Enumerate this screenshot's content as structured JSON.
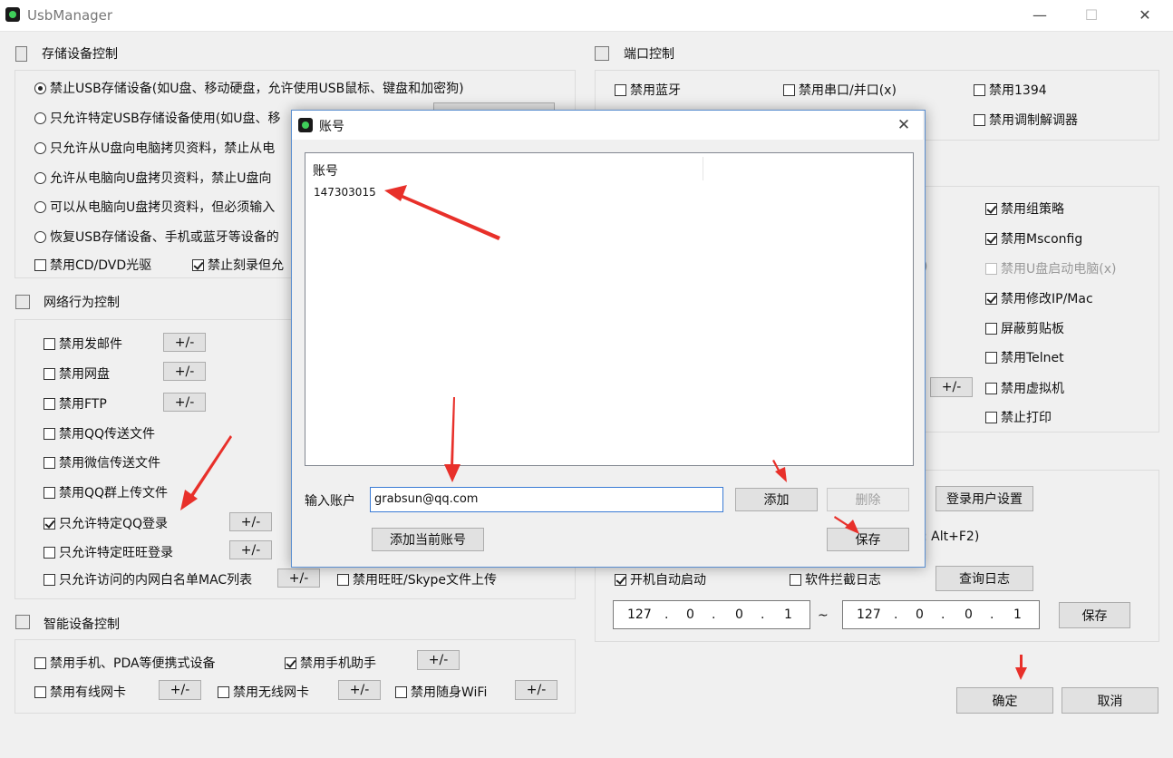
{
  "window": {
    "title": "UsbManager",
    "minimize": "—",
    "maximize": "☐",
    "close": "✕"
  },
  "storage": {
    "title": "存储设备控制",
    "radios": [
      {
        "label": "禁止USB存储设备(如U盘、移动硬盘，允许使用USB鼠标、键盘和加密狗)",
        "selected": true
      },
      {
        "label": "只允许特定USB存储设备使用(如U盘、移",
        "selected": false
      },
      {
        "label": "只允许从U盘向电脑拷贝资料，禁止从电",
        "selected": false
      },
      {
        "label": "允许从电脑向U盘拷贝资料，禁止U盘向",
        "selected": false
      },
      {
        "label": "可以从电脑向U盘拷贝资料，但必须输入",
        "selected": false
      },
      {
        "label": "恢复USB存储设备、手机或蓝牙等设备的",
        "selected": false
      }
    ],
    "cd_dvd": {
      "label": "禁用CD/DVD光驱",
      "checked": false
    },
    "burn": {
      "label": "禁止刻录但允",
      "checked": true
    }
  },
  "network": {
    "title": "网络行为控制",
    "items": [
      {
        "label": "禁用发邮件",
        "checked": false,
        "btn": "+/-"
      },
      {
        "label": "禁用网盘",
        "checked": false,
        "btn": "+/-"
      },
      {
        "label": "禁用FTP",
        "checked": false,
        "btn": "+/-"
      },
      {
        "label": "禁用QQ传送文件",
        "checked": false,
        "btn": ""
      },
      {
        "label": "禁用微信传送文件",
        "checked": false,
        "btn": ""
      },
      {
        "label": "禁用QQ群上传文件",
        "checked": false,
        "btn": ""
      },
      {
        "label": "只允许特定QQ登录",
        "checked": true,
        "btn": "+/-"
      },
      {
        "label": "只允许特定旺旺登录",
        "checked": false,
        "btn": "+/-"
      }
    ],
    "mac": {
      "label": "只允许访问的内网白名单MAC列表",
      "checked": false,
      "btn": "+/-"
    },
    "wangwang": {
      "label": "禁用旺旺/Skype文件上传",
      "checked": false
    }
  },
  "smart": {
    "title": "智能设备控制",
    "pda": {
      "label": "禁用手机、PDA等便携式设备",
      "checked": false
    },
    "assistant": {
      "label": "禁用手机助手",
      "checked": true,
      "btn": "+/-"
    },
    "wired": {
      "label": "禁用有线网卡",
      "checked": false,
      "btn": "+/-"
    },
    "wireless": {
      "label": "禁用无线网卡",
      "checked": false,
      "btn": "+/-"
    },
    "wifi": {
      "label": "禁用随身WiFi",
      "checked": false,
      "btn": "+/-"
    }
  },
  "port": {
    "title": "端口控制",
    "bluetooth": {
      "label": "禁用蓝牙",
      "checked": false
    },
    "serial": {
      "label": "禁用串口/并口(x)",
      "checked": false
    },
    "ieee1394": {
      "label": "禁用1394",
      "checked": false
    },
    "modem": {
      "label": "禁用调制解调器",
      "checked": false
    }
  },
  "os": {
    "items": [
      {
        "label": "禁用组策略",
        "checked": true,
        "disabled": false
      },
      {
        "label": "禁用Msconfig",
        "checked": true,
        "disabled": false
      },
      {
        "label": "禁用U盘启动电脑(x)",
        "checked": false,
        "disabled": true
      },
      {
        "label": "禁用修改IP/Mac",
        "checked": true,
        "disabled": false
      },
      {
        "label": "屏蔽剪贴板",
        "checked": false,
        "disabled": false
      },
      {
        "label": "禁用Telnet",
        "checked": false,
        "disabled": false
      },
      {
        "label": "禁用虚拟机",
        "checked": false,
        "disabled": false
      },
      {
        "label": "禁止打印",
        "checked": false,
        "disabled": false
      }
    ],
    "partial_paren": ")",
    "plusminus": "+/-"
  },
  "settings": {
    "login_user_settings": "登录用户设置",
    "hotkey_partial": ": Alt+F2)",
    "autostart": {
      "label": "开机自动启动",
      "checked": true
    },
    "block_log": {
      "label": "软件拦截日志",
      "checked": false
    },
    "query_log": "查询日志",
    "ip_from": [
      "127",
      "0",
      "0",
      "1"
    ],
    "ip_to": [
      "127",
      "0",
      "0",
      "1"
    ],
    "tilde": "~",
    "dot": ".",
    "save": "保存"
  },
  "footer": {
    "ok": "确定",
    "cancel": "取消"
  },
  "dialog": {
    "title": "账号",
    "close": "✕",
    "column_header": "账号",
    "accounts": [
      "147303015"
    ],
    "input_label": "输入账户",
    "input_value": "grabsun@qq.com",
    "add": "添加",
    "delete": "删除",
    "add_current": "添加当前账号",
    "save": "保存"
  },
  "colors": {
    "arrow": "#e8302a",
    "dialog_border": "#5a8ed0",
    "app_icon_green": "#3fcf5a"
  }
}
